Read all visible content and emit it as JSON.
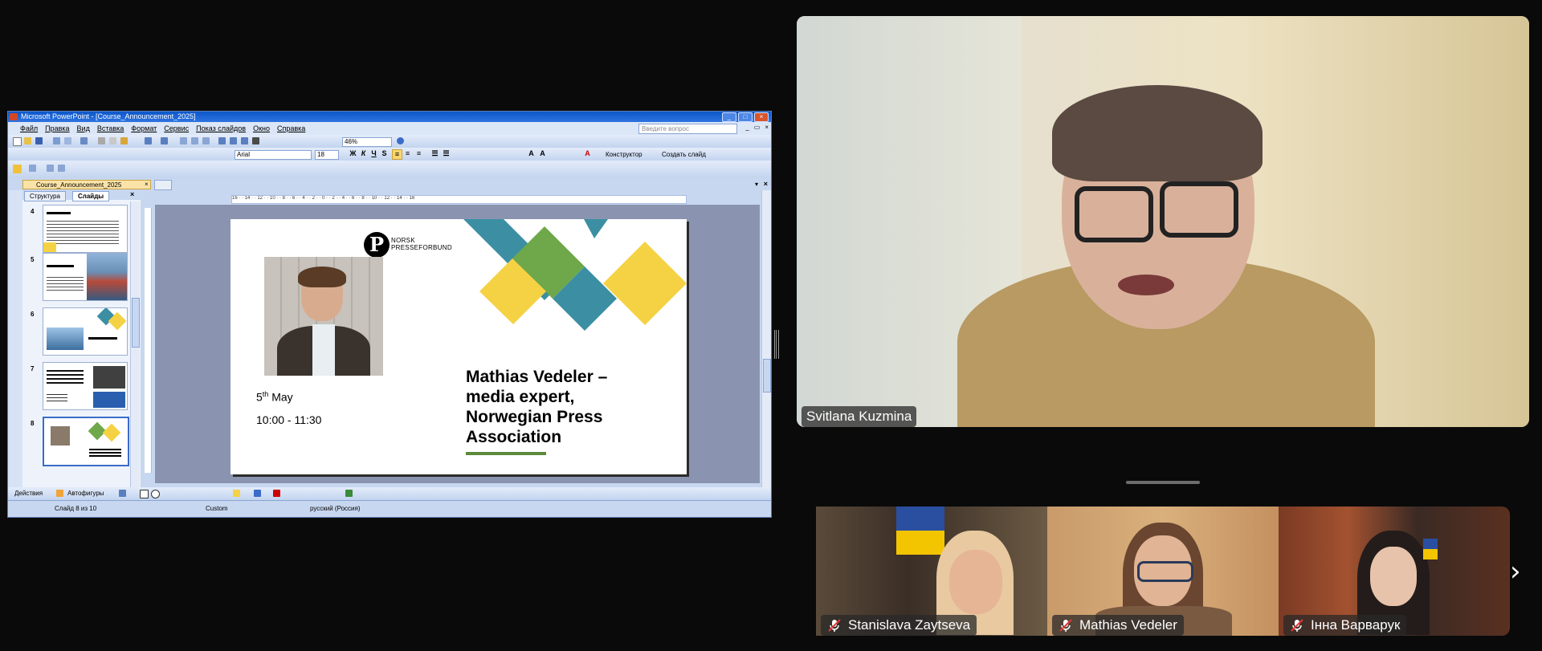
{
  "ppt": {
    "window_title": "Microsoft PowerPoint - [Course_Announcement_2025]",
    "menu": [
      "Файл",
      "Правка",
      "Вид",
      "Вставка",
      "Формат",
      "Сервис",
      "Показ слайдов",
      "Окно",
      "Справка"
    ],
    "ask_placeholder": "Введите вопрос",
    "zoom": "46%",
    "font_name": "Arial",
    "font_size": "18",
    "designer_label": "Конструктор",
    "new_slide_label": "Создать слайд",
    "doc_tab": "Course_Announcement_2025",
    "panel_tabs": [
      "Структура",
      "Слайды"
    ],
    "slide_numbers": [
      "4",
      "5",
      "6",
      "7",
      "8"
    ],
    "draw_actions": "Действия",
    "draw_autoshapes": "Автофигуры",
    "status_slide": "Слайд 8 из 10",
    "status_design": "Custom",
    "status_language": "русский (Россия)",
    "ruler_marks": "16 · · 14 · · 12 · · 10 · · 8 · · 6 · · 4 · · 2 · · 0 · · 2 · · 4 · · 6 · · 8 · · 10 · · 12 · · 14 · · 16"
  },
  "slide": {
    "logo_text_1": "NORSK",
    "logo_text_2": "PRESSEFORBUND",
    "logo_letter": "P",
    "speaker": "Mathias Vedeler – media expert, Norwegian Press Association",
    "date_day": "5",
    "date_suffix": "th",
    "date_month": " May",
    "time": "10:00 - 11:30",
    "colors": {
      "teal": "#3c8fa3",
      "green": "#6ea84b",
      "yellow": "#f5d244"
    }
  },
  "participants": {
    "main": {
      "name": "Svitlana Kuzmina"
    },
    "tiles": [
      {
        "name": "Stanislava Zaytseva",
        "muted": true
      },
      {
        "name": "Mathias Vedeler",
        "muted": true
      },
      {
        "name": "Інна Варварук",
        "muted": true
      }
    ]
  },
  "icons": {
    "next_page": "chevron-right-icon",
    "mic_off": "mic-off-icon"
  }
}
